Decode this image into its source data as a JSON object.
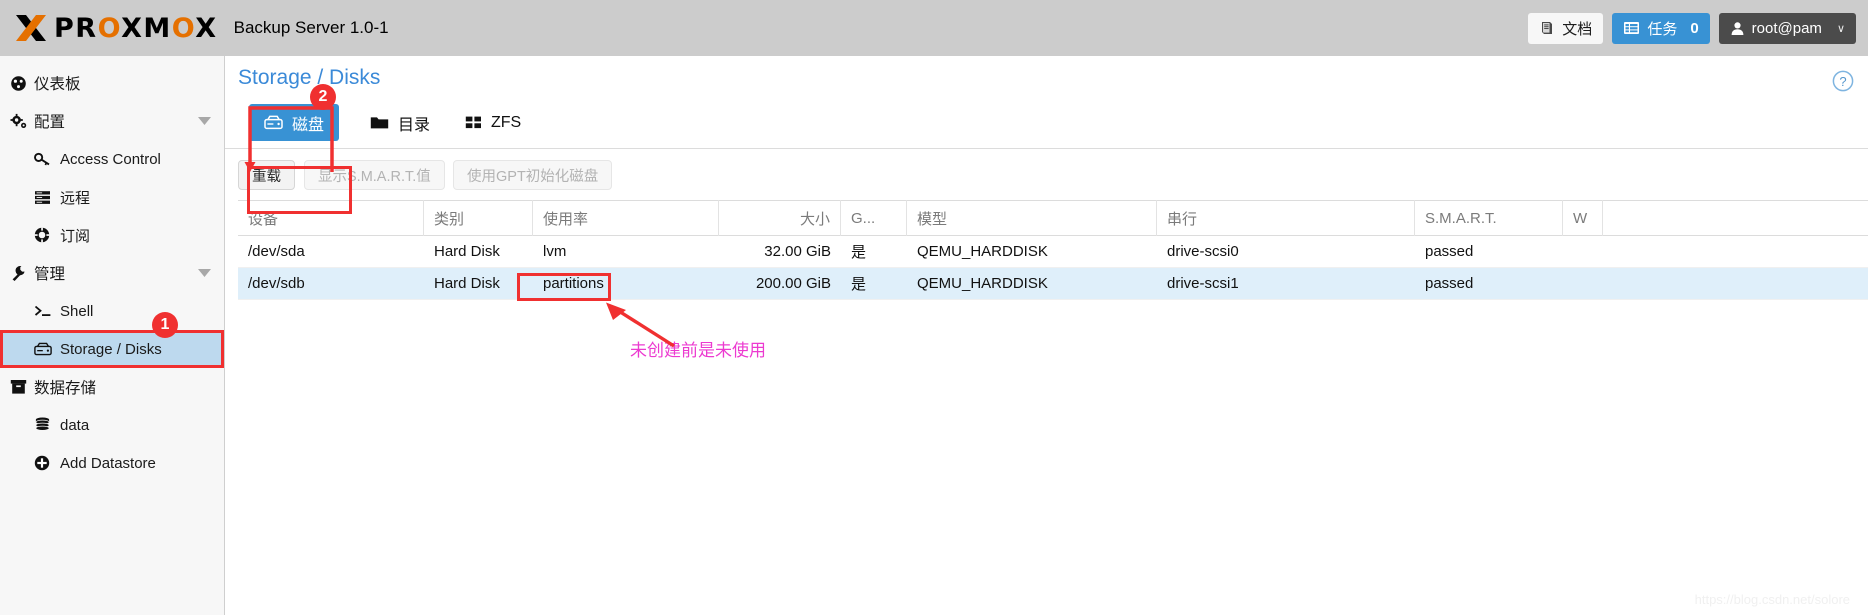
{
  "header": {
    "logo_text_1": "PR",
    "logo_text_o": "O",
    "logo_text_2": "XM",
    "logo_text_x": "O",
    "logo_text_3": "X",
    "brand": "PROXMOX",
    "app_title": "Backup Server 1.0-1",
    "docs_label": "文档",
    "docs_icon": "book-icon",
    "tasks_label": "任务",
    "tasks_count": "0",
    "tasks_icon": "list-icon",
    "user_label": "root@pam",
    "user_icon": "user-icon",
    "user_caret": "∨"
  },
  "sidebar": {
    "items": [
      {
        "label": "仪表板",
        "icon": "dashboard-icon",
        "level": "group",
        "name": "dashboard"
      },
      {
        "label": "配置",
        "icon": "gears-icon",
        "level": "group",
        "name": "configuration",
        "expandable": true
      },
      {
        "label": "Access Control",
        "icon": "key-icon",
        "level": "child",
        "name": "access-control"
      },
      {
        "label": "远程",
        "icon": "server-icon",
        "level": "child",
        "name": "remote"
      },
      {
        "label": "订阅",
        "icon": "lifering-icon",
        "level": "child",
        "name": "subscription"
      },
      {
        "label": "管理",
        "icon": "wrench-icon",
        "level": "group",
        "name": "management",
        "expandable": true
      },
      {
        "label": "Shell",
        "icon": "terminal-icon",
        "level": "child",
        "name": "shell"
      },
      {
        "label": "Storage / Disks",
        "icon": "hdd-icon",
        "level": "child",
        "name": "storage-disks",
        "selected": true
      },
      {
        "label": "数据存储",
        "icon": "archive-icon",
        "level": "group",
        "name": "datastore"
      },
      {
        "label": "data",
        "icon": "database-icon",
        "level": "child",
        "name": "data"
      },
      {
        "label": "Add Datastore",
        "icon": "plus-circle-icon",
        "level": "child",
        "name": "add-datastore"
      }
    ]
  },
  "main": {
    "title": "Storage / Disks",
    "help_icon": "question-circle-icon",
    "tabs": [
      {
        "label": "磁盘",
        "icon": "hdd-icon",
        "active": true,
        "name": "disks"
      },
      {
        "label": "目录",
        "icon": "folder-icon",
        "active": false,
        "name": "directory"
      },
      {
        "label": "ZFS",
        "icon": "grid-icon",
        "active": false,
        "name": "zfs"
      }
    ],
    "toolbar": [
      {
        "label": "重载",
        "disabled": false,
        "name": "reload-button"
      },
      {
        "label": "显示S.M.A.R.T.值",
        "disabled": true,
        "name": "show-smart-button"
      },
      {
        "label": "使用GPT初始化磁盘",
        "disabled": true,
        "name": "init-gpt-button"
      }
    ],
    "table": {
      "columns": [
        {
          "label": "设备",
          "key": "device",
          "align": "left"
        },
        {
          "label": "类别",
          "key": "type",
          "align": "left"
        },
        {
          "label": "使用率",
          "key": "usage",
          "align": "left"
        },
        {
          "label": "大小",
          "key": "size",
          "align": "right"
        },
        {
          "label": "G...",
          "key": "gpt",
          "align": "left"
        },
        {
          "label": "模型",
          "key": "model",
          "align": "left"
        },
        {
          "label": "串行",
          "key": "serial",
          "align": "left"
        },
        {
          "label": "S.M.A.R.T.",
          "key": "smart",
          "align": "left"
        },
        {
          "label": "W",
          "key": "w",
          "align": "left"
        }
      ],
      "rows": [
        {
          "device": "/dev/sda",
          "type": "Hard Disk",
          "usage": "lvm",
          "size": "32.00 GiB",
          "gpt": "是",
          "model": "QEMU_HARDDISK",
          "serial": "drive-scsi0",
          "smart": "passed",
          "w": "",
          "selected": false
        },
        {
          "device": "/dev/sdb",
          "type": "Hard Disk",
          "usage": "partitions",
          "size": "200.00 GiB",
          "gpt": "是",
          "model": "QEMU_HARDDISK",
          "serial": "drive-scsi1",
          "smart": "passed",
          "w": "",
          "selected": true
        }
      ]
    }
  },
  "annotations": {
    "badge_1": "1",
    "badge_2": "2",
    "note_text": "未创建前是未使用",
    "accent_red": "#f03030",
    "accent_magenta": "#ec3ad0"
  },
  "watermark": {
    "text": "https://blog.csdn.net/solore"
  }
}
